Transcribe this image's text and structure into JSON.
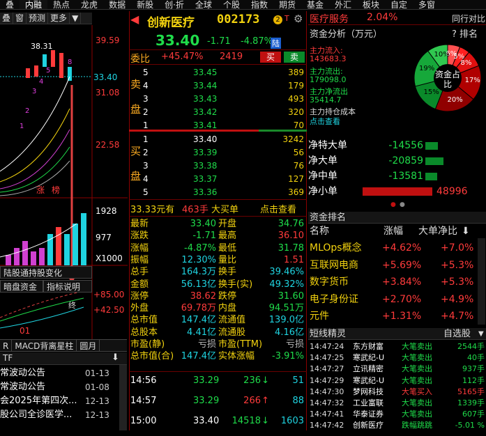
{
  "topbar": {
    "items": [
      "叠",
      "内融",
      "热点",
      "龙虎",
      "数据",
      "新股",
      "创·折",
      "全球",
      "个股",
      "指数",
      "期货",
      "基金",
      "外汇",
      "板块",
      "自定",
      "多窗"
    ]
  },
  "left": {
    "toolstrip": [
      "叠",
      "窗",
      "预测",
      "更多",
      "▼"
    ],
    "prices": {
      "p1": "39.59",
      "p2": "33.40",
      "p3": "31.08",
      "p4": "22.58",
      "p5": "1928",
      "p6": "977",
      "p7": "X1000",
      "p8": "+85.00",
      "p9": "+42.50"
    },
    "high_label": "38.31",
    "candle_nums": [
      "8",
      "5",
      "4",
      "3",
      "2",
      "1"
    ],
    "tags": [
      "涨",
      "榜"
    ],
    "tabs": {
      "t1": "陆股通持股变化",
      "t2": "暗盘资金",
      "t3": "指标说明",
      "end": "终",
      "x01": "01"
    },
    "bottom_tabs": [
      "R",
      "MACD背离星柱",
      "圆月"
    ],
    "tf_label": "TF",
    "news": [
      {
        "title": "常波动公告",
        "date": "01-13"
      },
      {
        "title": "常波动公告",
        "date": "01-08"
      },
      {
        "title": "会2025年第四次...",
        "date": "12-13"
      },
      {
        "title": "股公司全诊医学...",
        "date": "12-13"
      },
      {
        "title": "",
        "date": ""
      }
    ]
  },
  "stock": {
    "name": "创新医疗",
    "code": "002173",
    "badge": "2",
    "price": "33.40",
    "change": "-1.71",
    "pct": "-4.87%",
    "tag": "陆",
    "weibi_label": "委比",
    "weibi": "+45.47%",
    "weicha": "2419",
    "buy_btn": "买",
    "sell_btn": "卖",
    "sell_side": "卖盘",
    "buy_side": "买盘",
    "asks": [
      {
        "lvl": "5",
        "p": "33.45",
        "v": "389"
      },
      {
        "lvl": "4",
        "p": "33.44",
        "v": "179"
      },
      {
        "lvl": "3",
        "p": "33.43",
        "v": "493"
      },
      {
        "lvl": "2",
        "p": "33.42",
        "v": "320"
      },
      {
        "lvl": "1",
        "p": "33.41",
        "v": "70"
      }
    ],
    "bids": [
      {
        "lvl": "1",
        "p": "33.40",
        "v": "3242"
      },
      {
        "lvl": "2",
        "p": "33.39",
        "v": "56"
      },
      {
        "lvl": "3",
        "p": "33.38",
        "v": "76"
      },
      {
        "lvl": "4",
        "p": "33.37",
        "v": "127"
      },
      {
        "lvl": "5",
        "p": "33.36",
        "v": "369"
      }
    ],
    "bigorder": {
      "price": "33.33元有",
      "qty": "463手",
      "label": "大买单",
      "link": "点击查看"
    },
    "quote_left": [
      {
        "k": "最新",
        "v": "33.40",
        "c": "green"
      },
      {
        "k": "涨跌",
        "v": "-1.71",
        "c": "green"
      },
      {
        "k": "涨幅",
        "v": "-4.87%",
        "c": "green"
      },
      {
        "k": "振幅",
        "v": "12.30%",
        "c": "cyan"
      },
      {
        "k": "总手",
        "v": "164.3万",
        "c": "cyan"
      },
      {
        "k": "金额",
        "v": "56.13亿",
        "c": "cyan"
      },
      {
        "k": "涨停",
        "v": "38.62",
        "c": "red"
      },
      {
        "k": "外盘",
        "v": "69.78万",
        "c": "red"
      },
      {
        "k": "总市值",
        "v": "147.4亿",
        "c": "cyan"
      },
      {
        "k": "总股本",
        "v": "4.41亿",
        "c": "cyan"
      },
      {
        "k": "市盈(静)",
        "v": "亏损",
        "c": "gray"
      },
      {
        "k": "总市值(合)",
        "v": "147.4亿",
        "c": "cyan"
      }
    ],
    "quote_right": [
      {
        "k": "开盘",
        "v": "34.76",
        "c": "green"
      },
      {
        "k": "最高",
        "v": "36.10",
        "c": "red"
      },
      {
        "k": "最低",
        "v": "31.78",
        "c": "green"
      },
      {
        "k": "量比",
        "v": "1.51",
        "c": "red"
      },
      {
        "k": "换手",
        "v": "39.46%",
        "c": "cyan"
      },
      {
        "k": "换手(实)",
        "v": "49.32%",
        "c": "cyan"
      },
      {
        "k": "跌停",
        "v": "31.60",
        "c": "green"
      },
      {
        "k": "内盘",
        "v": "94.51万",
        "c": "green"
      },
      {
        "k": "流通值",
        "v": "139.0亿",
        "c": "cyan"
      },
      {
        "k": "流通股",
        "v": "4.16亿",
        "c": "cyan"
      },
      {
        "k": "市盈(TTM)",
        "v": "亏损",
        "c": "gray"
      },
      {
        "k": "实体涨幅",
        "v": "-3.91%",
        "c": "green"
      }
    ],
    "trades": [
      {
        "t": "14:56",
        "p": "33.29",
        "v": "236",
        "dir": "down",
        "n": "51"
      },
      {
        "t": "14:57",
        "p": "33.29",
        "v": "266",
        "dir": "up",
        "n": "88"
      },
      {
        "t": "15:00",
        "p": "33.40",
        "v": "14518",
        "dir": "down",
        "n": "1603"
      }
    ]
  },
  "sector": {
    "name": "医疗服务",
    "pct": "2.04%",
    "btn": "同行对比"
  },
  "capital": {
    "title": "资金分析（万元）",
    "tools": "? 排名",
    "main_in_label": "主力流入:",
    "main_in": "143683.3",
    "main_out_label": "主力流出:",
    "main_out": "179098.0",
    "main_net_label": "主力净流出",
    "main_net": "35414.7",
    "hold_label": "主力持仓成本",
    "hold_link": "点击查看",
    "donut_center": "资金占比",
    "donut_labels": [
      "6%",
      "5%",
      "8%",
      "17%",
      "20%",
      "15%",
      "19%",
      "10%"
    ],
    "flows": [
      {
        "label": "净特大单",
        "val": "-14556",
        "frac": 0.3,
        "c": "green"
      },
      {
        "label": "净大单",
        "val": "-20859",
        "frac": 0.43,
        "c": "green"
      },
      {
        "label": "净中单",
        "val": "-13581",
        "frac": 0.28,
        "c": "green"
      },
      {
        "label": "净小单",
        "val": "48996",
        "frac": 1.0,
        "c": "red"
      }
    ]
  },
  "ranking": {
    "title": "资金排名",
    "cols": [
      "名称",
      "涨幅",
      "大单净比"
    ],
    "rows": [
      {
        "n": "MLOps概念",
        "z": "+4.62%",
        "d": "+7.0%"
      },
      {
        "n": "互联网电商",
        "z": "+5.69%",
        "d": "+5.3%"
      },
      {
        "n": "数字货币",
        "z": "+3.84%",
        "d": "+5.3%"
      },
      {
        "n": "电子身份证",
        "z": "+2.70%",
        "d": "+4.9%"
      },
      {
        "n": "元件",
        "z": "+1.31%",
        "d": "+4.7%"
      }
    ]
  },
  "elf": {
    "title": "短线精灵",
    "select": "自选股",
    "rows": [
      {
        "t": "14:47:24",
        "n": "东方财富",
        "e": "大笔卖出",
        "ec": "green",
        "v": "2544手",
        "vc": "green"
      },
      {
        "t": "14:47:25",
        "n": "寒武纪-U",
        "e": "大笔卖出",
        "ec": "green",
        "v": "40手",
        "vc": "green"
      },
      {
        "t": "14:47:27",
        "n": "立讯精密",
        "e": "大笔卖出",
        "ec": "green",
        "v": "937手",
        "vc": "green"
      },
      {
        "t": "14:47:29",
        "n": "寒武纪-U",
        "e": "大笔卖出",
        "ec": "green",
        "v": "112手",
        "vc": "green"
      },
      {
        "t": "14:47:30",
        "n": "梦网科技",
        "e": "大笔买入",
        "ec": "red",
        "v": "5165手",
        "vc": "red"
      },
      {
        "t": "14:47:32",
        "n": "工业富联",
        "e": "大笔卖出",
        "ec": "green",
        "v": "1339手",
        "vc": "green"
      },
      {
        "t": "14:47:41",
        "n": "华泰证券",
        "e": "大笔卖出",
        "ec": "green",
        "v": "607手",
        "vc": "green"
      },
      {
        "t": "14:47:42",
        "n": "创新医疗",
        "e": "跌幅跳跳",
        "ec": "green",
        "v": "-5.01 %",
        "vc": "green"
      }
    ]
  },
  "colors": {
    "red": "#ff3b3b",
    "green": "#1fdc4a",
    "cyan": "#1fd3e0",
    "yellow": "#f2d20f",
    "bg": "#000000"
  }
}
